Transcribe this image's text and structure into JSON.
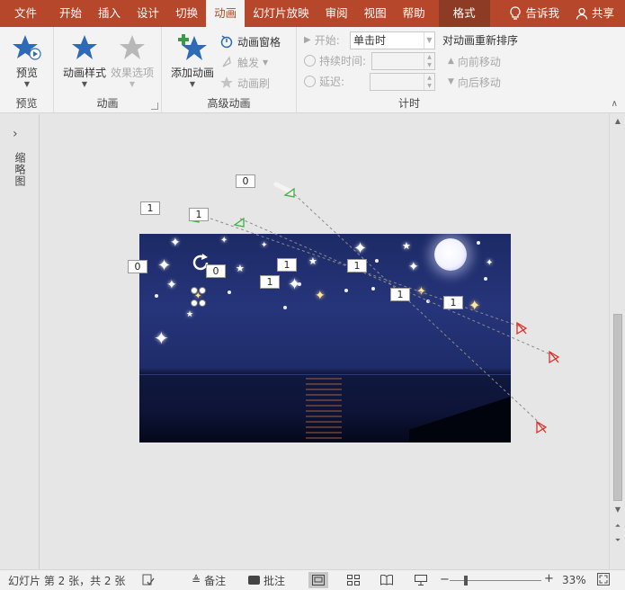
{
  "tabs": {
    "file": "文件",
    "home": "开始",
    "insert": "插入",
    "design": "设计",
    "transitions": "切换",
    "animations": "动画",
    "slideshow": "幻灯片放映",
    "review": "审阅",
    "view": "视图",
    "help": "帮助",
    "format": "格式",
    "tellme": "告诉我",
    "share": "共享"
  },
  "ribbon": {
    "preview": {
      "button": "预览",
      "group": "预览"
    },
    "animation": {
      "styles": "动画样式",
      "effect_options": "效果选项",
      "group": "动画"
    },
    "advanced": {
      "add": "添加动画",
      "pane": "动画窗格",
      "trigger": "触发",
      "painter": "动画刷",
      "group": "高级动画"
    },
    "timing": {
      "start_label": "开始:",
      "start_value": "单击时",
      "duration_label": "持续时间:",
      "delay_label": "延迟:",
      "reorder_title": "对动画重新排序",
      "move_earlier": "向前移动",
      "move_later": "向后移动",
      "group": "计时"
    }
  },
  "thumbnail_pane": {
    "label": "缩略图"
  },
  "animation_tags": {
    "t1": "0",
    "t2": "1",
    "t3": "1",
    "t4": "0",
    "t5": "0",
    "t6": "1",
    "t7": "1",
    "t8": "1",
    "t9": "1",
    "t10": "1"
  },
  "status": {
    "slide_info": "幻灯片 第 2 张，共 2 张",
    "notes": "备注",
    "comments": "批注",
    "zoom": "33%"
  },
  "colors": {
    "accent": "#b7472a",
    "path_start": "#3cb043",
    "path_end": "#e0302a"
  }
}
